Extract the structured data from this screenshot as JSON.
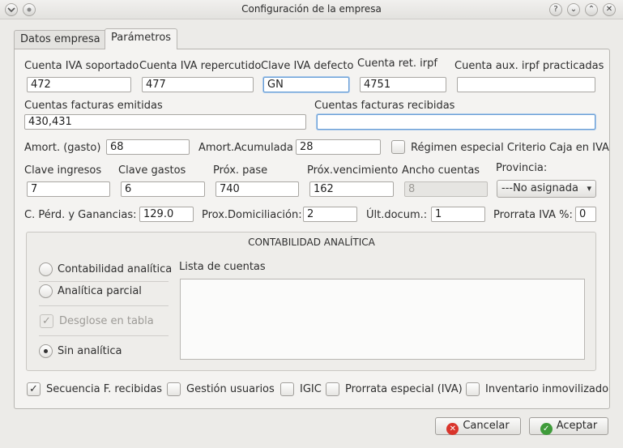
{
  "window": {
    "title": "Configuración de la empresa"
  },
  "tabs": [
    {
      "label": "Datos empresa"
    },
    {
      "label": "Parámetros"
    }
  ],
  "fields": {
    "iva_soportado": {
      "label": "Cuenta IVA soportado",
      "value": "472"
    },
    "iva_repercutido": {
      "label": "Cuenta IVA repercutido",
      "value": "477"
    },
    "clave_iva": {
      "label": "Clave IVA defecto",
      "value": "GN"
    },
    "ret_irpf": {
      "label": "Cuenta ret. irpf",
      "value": "4751"
    },
    "aux_irpf": {
      "label": "Cuenta aux. irpf practicadas",
      "value": ""
    },
    "facturas_emitidas": {
      "label": "Cuentas facturas emitidas",
      "value": "430,431"
    },
    "facturas_recibidas": {
      "label": "Cuentas facturas recibidas",
      "value": ""
    },
    "amort_gasto": {
      "label": "Amort. (gasto)",
      "value": "68"
    },
    "amort_acum": {
      "label": "Amort.Acumulada",
      "value": "28"
    },
    "clave_ingresos": {
      "label": "Clave ingresos",
      "value": "7"
    },
    "clave_gastos": {
      "label": "Clave gastos",
      "value": "6"
    },
    "prox_pase": {
      "label": "Próx. pase",
      "value": "740"
    },
    "prox_venc": {
      "label": "Próx.vencimiento",
      "value": "162"
    },
    "ancho_cuentas": {
      "label": "Ancho cuentas",
      "value": "8"
    },
    "perd_ganancias": {
      "label": "C. Pérd. y Ganancias:",
      "value": "129.0"
    },
    "prox_domic": {
      "label": "Prox.Domiciliación:",
      "value": "2"
    },
    "ult_docum": {
      "label": "Últ.docum.:",
      "value": "1"
    },
    "prorrata_iva": {
      "label": "Prorrata IVA %:",
      "value": "0"
    }
  },
  "regimen_caja": {
    "label": "Régimen especial Criterio Caja en IVA",
    "checked": false
  },
  "provincia": {
    "label": "Provincia:",
    "selected": "---No asignada"
  },
  "analitica": {
    "title": "CONTABILIDAD ANALÍTICA",
    "options": [
      {
        "label": "Contabilidad analítica",
        "selected": false
      },
      {
        "label": "Analítica parcial",
        "selected": false
      },
      {
        "label": "Desglose en tabla",
        "checked": true,
        "disabled": true
      },
      {
        "label": "Sin analítica",
        "selected": true
      }
    ],
    "list_label": "Lista de cuentas"
  },
  "flags": [
    {
      "label": "Secuencia F. recibidas",
      "checked": true
    },
    {
      "label": "Gestión usuarios",
      "checked": false
    },
    {
      "label": "IGIC",
      "checked": false
    },
    {
      "label": "Prorrata especial (IVA)",
      "checked": false
    },
    {
      "label": "Inventario inmovilizado",
      "checked": false
    }
  ],
  "buttons": {
    "cancel": "Cancelar",
    "accept": "Aceptar"
  },
  "titlebar_buttons": [
    "?",
    "⌄",
    "⌃",
    "✕"
  ],
  "colors": {
    "accent_focus": "#6a9fd6",
    "cancel_icon": "#d9342b",
    "accept_icon": "#3f9b3a"
  }
}
